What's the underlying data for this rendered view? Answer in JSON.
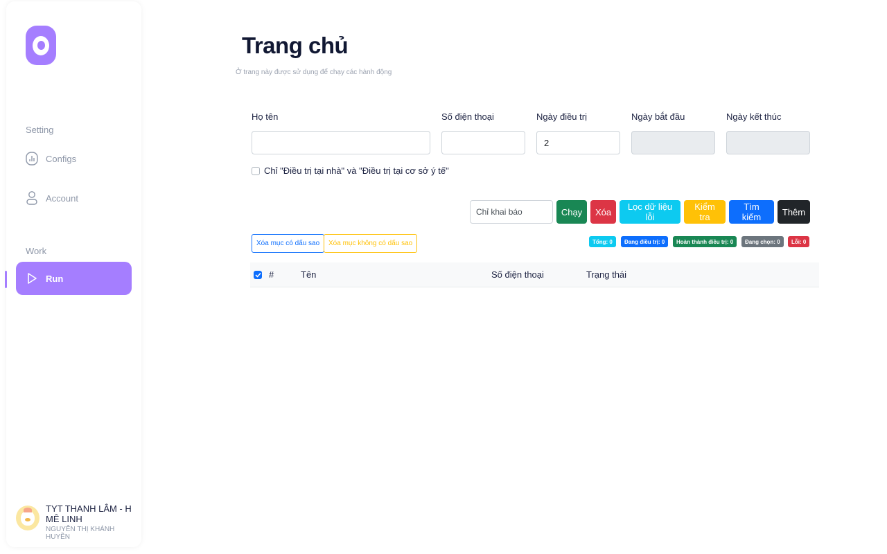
{
  "sidebar": {
    "logo": "app-logo",
    "sections": [
      {
        "label": "Setting"
      },
      {
        "label": "Work"
      }
    ],
    "items": [
      {
        "label": "Configs",
        "icon": "chart-icon"
      },
      {
        "label": "Account",
        "icon": "user-icon"
      },
      {
        "label": "Run",
        "icon": "play-icon",
        "active": true
      }
    ],
    "user": {
      "name": "TYT THANH LÂM - H MÊ LINH",
      "subtitle": "NGUYỄN THỊ KHÁNH HUYỀN",
      "avatar": "duck-avatar"
    }
  },
  "header": {
    "title": "Trang chủ",
    "subtitle": "Ở trang này được sử dụng để chạy các hành động"
  },
  "form": {
    "fields": [
      {
        "label": "Họ tên",
        "value": "",
        "disabled": false
      },
      {
        "label": "Số điện thoại",
        "value": "",
        "disabled": false
      },
      {
        "label": "Ngày điều trị",
        "value": "2",
        "disabled": false
      },
      {
        "label": "Ngày bắt đầu",
        "value": "",
        "disabled": true
      },
      {
        "label": "Ngày kết thúc",
        "value": "",
        "disabled": true
      }
    ],
    "checkbox": {
      "label": "Chỉ \"Điều trị tại nhà\" và \"Điều trị tại cơ sở ý tế\"",
      "checked": false
    }
  },
  "toolbar": {
    "filter_input_value": "Chỉ khai báo",
    "buttons": [
      {
        "label": "Chạy",
        "color": "#198754"
      },
      {
        "label": "Xóa",
        "color": "#dc3545"
      },
      {
        "label": "Lọc dữ liệu lỗi",
        "color": "#0dcaf0"
      },
      {
        "label": "Kiểm tra",
        "color": "#ffc107"
      },
      {
        "label": "Tìm kiếm",
        "color": "#0d6efd"
      },
      {
        "label": "Thêm",
        "color": "#212529"
      }
    ],
    "outline_buttons": [
      {
        "label": "Xóa mục có dấu sao",
        "color": "#0d6efd"
      },
      {
        "label": "Xóa mục không có dấu sao",
        "color": "#ffc107"
      }
    ],
    "badges": [
      {
        "label": "Tổng: 0",
        "color": "#0dcaf0"
      },
      {
        "label": "Đang điều trị: 0",
        "color": "#0d6efd"
      },
      {
        "label": "Hoàn thành điều trị: 0",
        "color": "#198754"
      },
      {
        "label": "Đang chọn: 0",
        "color": "#6c757d"
      },
      {
        "label": "Lỗi: 0",
        "color": "#dc3545"
      }
    ]
  },
  "table": {
    "select_all_checked": true,
    "columns": [
      "#",
      "Tên",
      "Số điện thoại",
      "Trạng thái"
    ],
    "rows": []
  }
}
